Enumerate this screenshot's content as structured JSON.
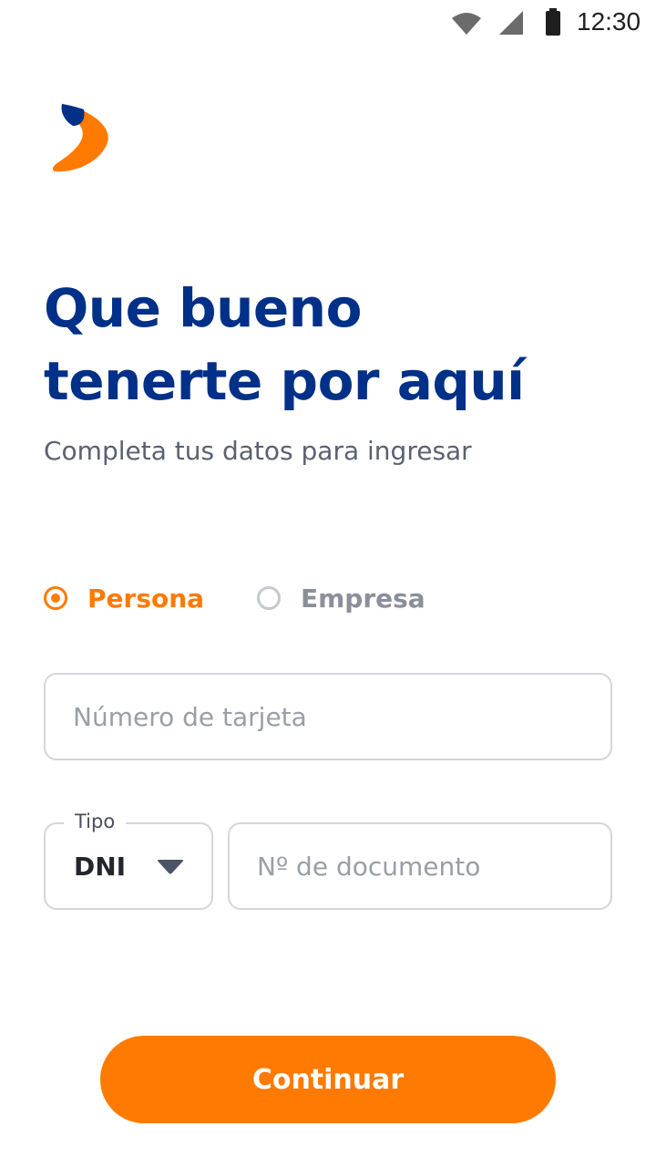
{
  "status_bar": {
    "time": "12:30",
    "icons": [
      "wifi-icon",
      "cell-signal-icon",
      "battery-icon"
    ]
  },
  "brand": {
    "logo": "brand-logo",
    "colors": {
      "primary": "#003087",
      "accent": "#ff7a00"
    }
  },
  "header": {
    "title_line1": "Que bueno",
    "title_line2": "tenerte por aquí",
    "subtitle": "Completa tus datos para ingresar"
  },
  "account_type": {
    "options": [
      {
        "label": "Persona",
        "selected": true
      },
      {
        "label": "Empresa",
        "selected": false
      }
    ]
  },
  "form": {
    "card_number": {
      "placeholder": "Número de tarjeta",
      "value": ""
    },
    "doc_type": {
      "label": "Tipo",
      "value": "DNI"
    },
    "doc_number": {
      "placeholder": "Nº de documento",
      "value": ""
    }
  },
  "actions": {
    "continue_label": "Continuar"
  }
}
